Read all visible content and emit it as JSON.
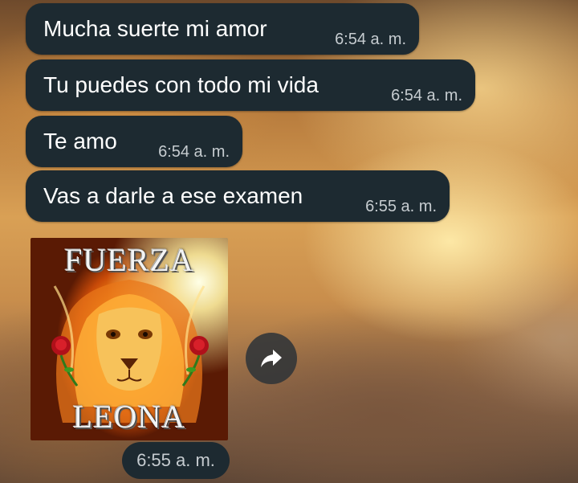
{
  "messages": [
    {
      "text": "Mucha suerte mi amor",
      "time": "6:54 a. m."
    },
    {
      "text": "Tu puedes con todo mi vida",
      "time": "6:54 a. m."
    },
    {
      "text": "Te amo",
      "time": "6:54 a. m."
    },
    {
      "text": "Vas a darle a ese examen",
      "time": "6:55 a. m."
    }
  ],
  "sticker": {
    "top_text": "FUERZA",
    "bottom_text": "LEONA",
    "time": "6:55 a. m."
  },
  "icons": {
    "forward": "forward-arrow-icon"
  },
  "colors": {
    "bubble": "#1d2a31",
    "timestamp": "#c6ccd0"
  }
}
